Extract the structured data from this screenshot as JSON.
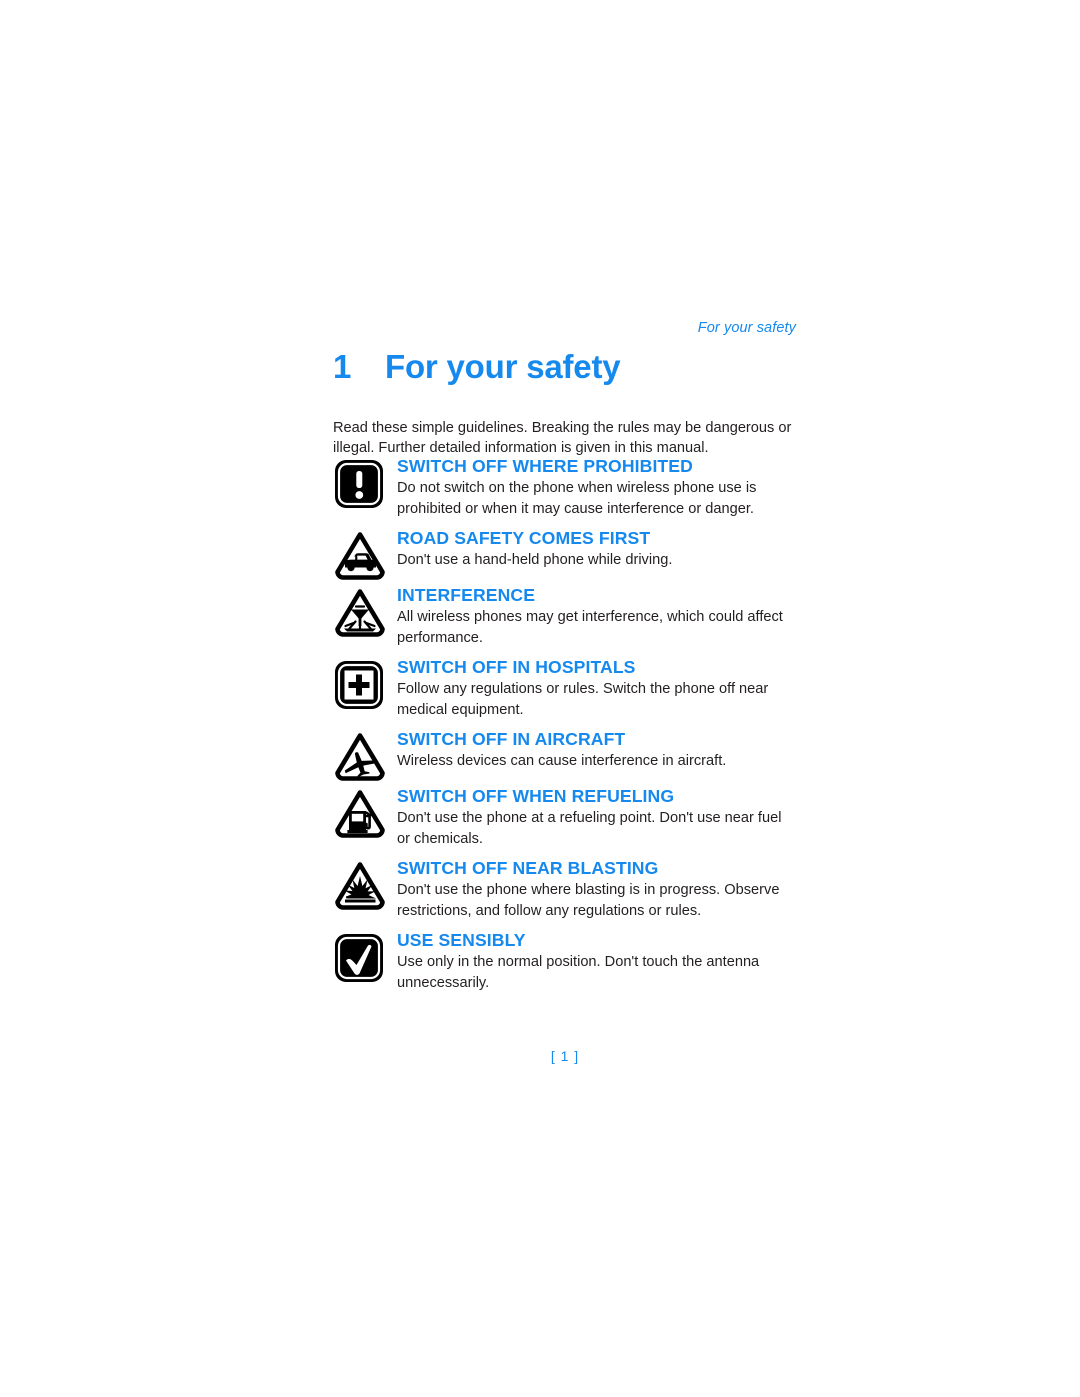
{
  "document": {
    "running_header": "For your safety",
    "chapter_number": "1",
    "chapter_title": "For your safety",
    "intro": "Read these simple guidelines. Breaking the rules may be dangerous or illegal. Further detailed information is given in this manual.",
    "page_number": "[ 1 ]",
    "accent_color": "#1589EE",
    "text_color": "#231f20"
  },
  "safety_items": [
    {
      "icon": "exclamation-square-icon",
      "heading": "SWITCH OFF WHERE PROHIBITED",
      "body": "Do not switch on the phone when wireless phone use is prohibited or when it may cause interference or danger."
    },
    {
      "icon": "car-triangle-icon",
      "heading": "ROAD SAFETY COMES FIRST",
      "body": "Don't use a hand-held phone while driving."
    },
    {
      "icon": "interference-triangle-icon",
      "heading": "INTERFERENCE",
      "body": "All wireless phones may get interference, which could affect performance."
    },
    {
      "icon": "hospital-cross-square-icon",
      "heading": "SWITCH OFF IN HOSPITALS",
      "body": "Follow any regulations or rules. Switch the phone off near medical equipment."
    },
    {
      "icon": "airplane-triangle-icon",
      "heading": "SWITCH OFF IN AIRCRAFT",
      "body": "Wireless devices can cause interference in aircraft."
    },
    {
      "icon": "fuel-pump-triangle-icon",
      "heading": "SWITCH OFF WHEN REFUELING",
      "body": "Don't use the phone at a refueling point. Don't use near fuel or chemicals."
    },
    {
      "icon": "blasting-triangle-icon",
      "heading": "SWITCH OFF NEAR BLASTING",
      "body": "Don't use the phone where blasting is in progress. Observe restrictions, and follow any regulations or rules."
    },
    {
      "icon": "checkmark-square-icon",
      "heading": "USE SENSIBLY",
      "body": "Use only in the normal position. Don't touch the antenna unnecessarily."
    }
  ]
}
